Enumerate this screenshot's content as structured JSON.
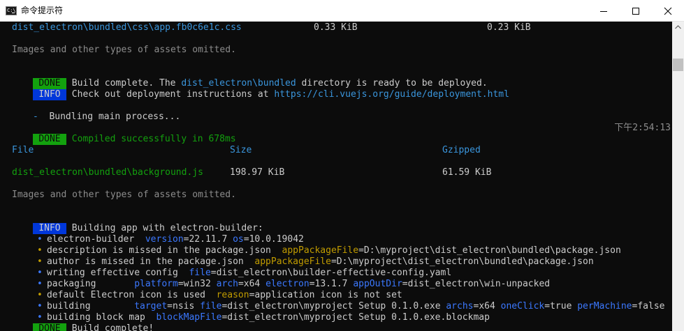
{
  "window": {
    "title": "命令提示符",
    "icon_text": "C:\\"
  },
  "lines": {
    "l1": {
      "path": "dist_electron\\bundled\\css\\app.fb0c6e1c.css",
      "size": "0.33 KiB",
      "gzipped": "0.23 KiB"
    },
    "l2": {
      "text": "Images and other types of assets omitted."
    },
    "l3": {
      "badge": "DONE",
      "pre": " Build complete. The ",
      "path": "dist_electron\\bundled",
      "post": " directory is ready to be deployed."
    },
    "l4": {
      "badge": "INFO",
      "pre": " Check out deployment instructions at ",
      "url": "https://cli.vuejs.org/guide/deployment.html"
    },
    "l5": {
      "spinner": "-",
      "text": "  Bundling main process..."
    },
    "l6": {
      "badge": "DONE",
      "text": " Compiled successfully in 678ms",
      "time": "下午2:54:13"
    },
    "l7": {
      "file": "File",
      "size": "Size",
      "gzipped": "Gzipped"
    },
    "l8": {
      "path": "dist_electron\\bundled\\background.js",
      "size": "198.97 KiB",
      "gzipped": "61.59 KiB"
    },
    "l9": {
      "text": "Images and other types of assets omitted."
    },
    "l10": {
      "badge": "INFO",
      "text": " Building app with electron-builder:"
    },
    "l11": {
      "bullet": "•",
      "label": "electron-builder  ",
      "k1": "version",
      "v1": "=22.11.7 ",
      "k2": "os",
      "v2": "=10.0.19042"
    },
    "l12": {
      "bullet": "•",
      "label": "description is missed in the package.json  ",
      "k1": "appPackageFile",
      "v1": "=D:\\myproject\\dist_electron\\bundled\\package.json"
    },
    "l13": {
      "bullet": "•",
      "label": "author is missed in the package.json  ",
      "k1": "appPackageFile",
      "v1": "=D:\\myproject\\dist_electron\\bundled\\package.json"
    },
    "l14": {
      "bullet": "•",
      "label": "writing effective config  ",
      "k1": "file",
      "v1": "=dist_electron\\builder-effective-config.yaml"
    },
    "l15": {
      "bullet": "•",
      "label": "packaging       ",
      "k1": "platform",
      "v1": "=win32 ",
      "k2": "arch",
      "v2": "=x64 ",
      "k3": "electron",
      "v3": "=13.1.7 ",
      "k4": "appOutDir",
      "v4": "=dist_electron\\win-unpacked"
    },
    "l16": {
      "bullet": "•",
      "label": "default Electron icon is used  ",
      "k1": "reason",
      "v1": "=application icon is not set"
    },
    "l17": {
      "bullet": "•",
      "label": "building        ",
      "k1": "target",
      "v1": "=nsis ",
      "k2": "file",
      "v2": "=dist_electron\\myproject Setup 0.1.0.exe ",
      "k3": "archs",
      "v3": "=x64 ",
      "k4": "oneClick",
      "v4": "=true ",
      "k5": "perMachine",
      "v5": "=false"
    },
    "l18": {
      "bullet": "•",
      "label": "building block map  ",
      "k1": "blockMapFile",
      "v1": "=dist_electron\\myproject Setup 0.1.0.exe.blockmap"
    },
    "l19": {
      "badge": "DONE",
      "text": " Build complete!"
    }
  }
}
